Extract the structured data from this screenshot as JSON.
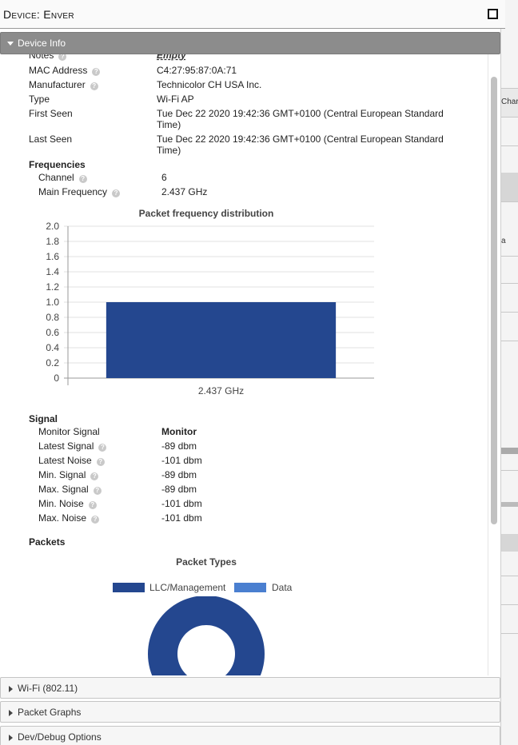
{
  "window": {
    "title": "Device: Enver"
  },
  "sections": {
    "device_info": "Device Info",
    "wifi": "Wi-Fi (802.11)",
    "packet_graphs": "Packet Graphs",
    "dev_debug": "Dev/Debug Options"
  },
  "fields": {
    "notes": {
      "label": "Notes",
      "value": "Empty"
    },
    "mac": {
      "label": "MAC Address",
      "value": "C4:27:95:87:0A:71"
    },
    "manufacturer": {
      "label": "Manufacturer",
      "value": "Technicolor CH USA Inc."
    },
    "type": {
      "label": "Type",
      "value": "Wi-Fi AP"
    },
    "first_seen": {
      "label": "First Seen",
      "value": "Tue Dec 22 2020 19:42:36 GMT+0100 (Central European Standard Time)"
    },
    "last_seen": {
      "label": "Last Seen",
      "value": "Tue Dec 22 2020 19:42:36 GMT+0100 (Central European Standard Time)"
    }
  },
  "frequencies": {
    "heading": "Frequencies",
    "channel": {
      "label": "Channel",
      "value": "6"
    },
    "main_frequency": {
      "label": "Main Frequency",
      "value": "2.437 GHz"
    }
  },
  "signal": {
    "heading": "Signal",
    "monitor_signal": {
      "label": "Monitor Signal",
      "value": "Monitor"
    },
    "latest_signal": {
      "label": "Latest Signal",
      "value": "-89 dbm"
    },
    "latest_noise": {
      "label": "Latest Noise",
      "value": "-101 dbm"
    },
    "min_signal": {
      "label": "Min. Signal",
      "value": "-89 dbm"
    },
    "max_signal": {
      "label": "Max. Signal",
      "value": "-89 dbm"
    },
    "min_noise": {
      "label": "Min. Noise",
      "value": "-101 dbm"
    },
    "max_noise": {
      "label": "Max. Noise",
      "value": "-101 dbm"
    }
  },
  "packets": {
    "heading": "Packets"
  },
  "background": {
    "tab_fragment": "Char",
    "cell_fragment": "a"
  },
  "help_glyph": "?",
  "colors": {
    "bar": "#24478f",
    "llc": "#24478f",
    "data": "#4a7fd0",
    "header_active": "#8c8c8c"
  },
  "chart_data": [
    {
      "type": "bar",
      "title": "Packet frequency distribution",
      "categories": [
        "2.437 GHz"
      ],
      "values": [
        1
      ],
      "ylim": [
        0,
        2
      ],
      "yticks": [
        "2.0",
        "1.8",
        "1.6",
        "1.4",
        "1.2",
        "1.0",
        "0.8",
        "0.6",
        "0.4",
        "0.2",
        "0"
      ],
      "xlabel": "",
      "ylabel": "",
      "grid": true
    },
    {
      "type": "pie",
      "title": "Packet Types",
      "series": [
        {
          "name": "LLC/Management",
          "value": 1
        },
        {
          "name": "Data",
          "value": 0
        }
      ],
      "legend": "top"
    }
  ]
}
